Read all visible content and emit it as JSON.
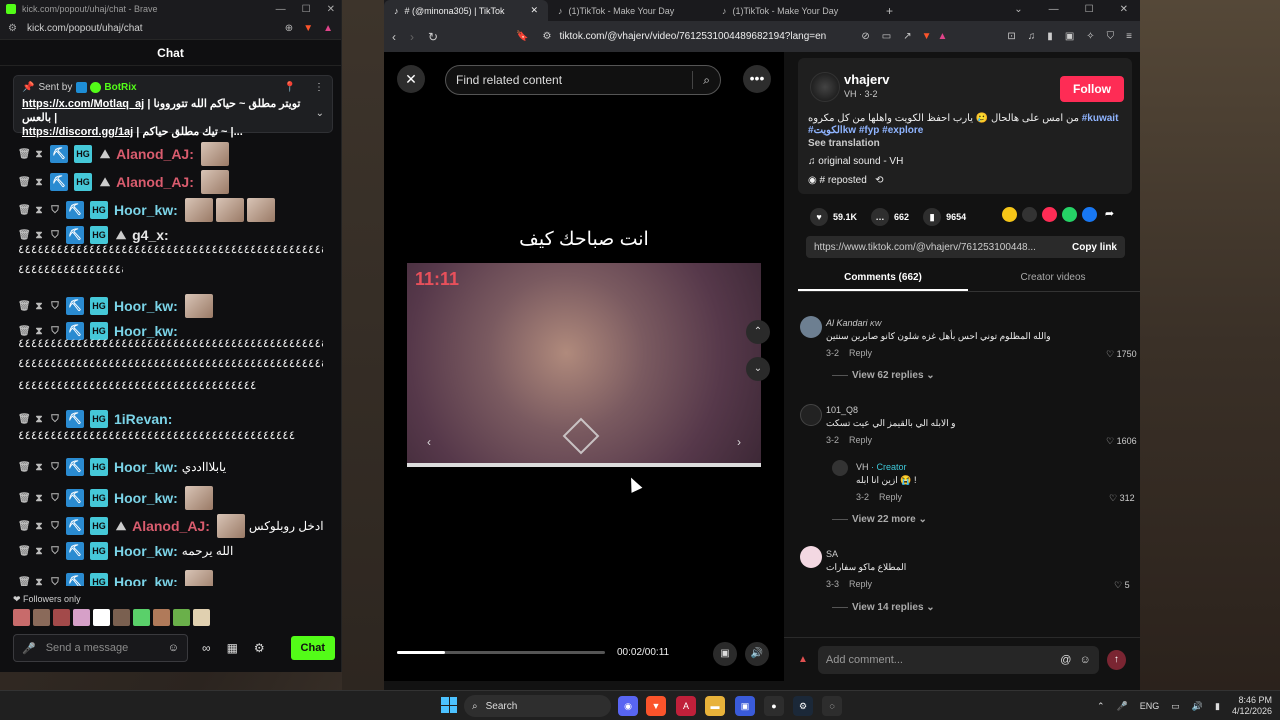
{
  "kick": {
    "window_title": "kick.com/popout/uhaj/chat - Brave",
    "url": "kick.com/popout/uhaj/chat",
    "chat_header": "Chat",
    "pinned": {
      "sent_by": "Sent by",
      "bot_name": "BotRix",
      "line1_link": "https://x.com/Motlaq_aj",
      "line1_text": "| تويتر مطلق ~ حياكم الله تتوروونا بالعس |",
      "line2_link": "https://discord.gg/1aj",
      "line2_text": "| تيك مطلق حياكم ~ |..."
    },
    "messages": [
      {
        "user": "Alanod_AJ:",
        "color": "#d95c6e",
        "mountain": true
      },
      {
        "user": "Alanod_AJ:",
        "color": "#d95c6e",
        "mountain": true
      },
      {
        "user": "Hoor_kw:",
        "color": "#7bd4e8"
      },
      {
        "user": "g4_x:",
        "color": "#e6e6e6",
        "mountain": true
      },
      {
        "user": "Hoor_kw:",
        "color": "#7bd4e8"
      },
      {
        "user": "Hoor_kw:",
        "color": "#7bd4e8"
      },
      {
        "user": "1iRevan:",
        "color": "#7bd4e8"
      },
      {
        "user": "Hoor_kw:",
        "color": "#7bd4e8",
        "text": "يابلاااددي"
      },
      {
        "user": "Hoor_kw:",
        "color": "#7bd4e8"
      },
      {
        "user": "Alanod_AJ:",
        "color": "#d95c6e",
        "mountain": true,
        "text": "ادخل روبلوكس"
      },
      {
        "user": "Hoor_kw:",
        "color": "#7bd4e8",
        "text": "الله يرحمه"
      },
      {
        "user": "Hoor_kw:",
        "color": "#7bd4e8"
      }
    ],
    "followers_only": "Followers only",
    "input_placeholder": "Send a message",
    "chat_button": "Chat"
  },
  "brave": {
    "tabs": [
      {
        "title": "# (@minona305) | TikTok",
        "active": true
      },
      {
        "title": "(1)TikTok - Make Your Day",
        "active": false
      },
      {
        "title": "(1)TikTok - Make Your Day",
        "active": false
      }
    ],
    "address": "tiktok.com/@vhajerv/video/7612531004489682194?lang=en"
  },
  "tiktok": {
    "search_placeholder": "Find related content",
    "caption": "انت صباحك كيف",
    "video_counter": "11:11",
    "progress": 0.23,
    "time": "00:02/00:11",
    "author": {
      "name": "vhajerv",
      "sub": "VH · 3-2",
      "follow": "Follow",
      "desc_text": "من امس على هالحال 🥲 يارب احفظ الكويت واهلها من كل مكروه",
      "tags": [
        "#kuwait",
        "#الكويتkw",
        "#fyp",
        "#explore"
      ],
      "see_translation": "See translation",
      "sound": "original sound - VH",
      "reposted": "# reposted"
    },
    "stats": {
      "likes": "59.1K",
      "comments": "662",
      "saves": "9654"
    },
    "share_colors": [
      "#f5c518",
      "#333333",
      "#fe2c55",
      "#25d366",
      "#1877f2"
    ],
    "link": "https://www.tiktok.com/@vhajerv/761253100448...",
    "copy_link": "Copy link",
    "tab_comments": "Comments (662)",
    "tab_creator": "Creator videos",
    "comments": [
      {
        "name": "Al Kandari",
        "name_suffix": "KW",
        "text": "والله المظلوم توني احس بأهل غزه شلون كانو صابرين سنتين",
        "date": "3-2",
        "reply": "Reply",
        "likes": "1750",
        "more": "View 62 replies"
      },
      {
        "name": "101_Q8",
        "text": "و الابله الي بالقيمز الي عيت تسكت",
        "date": "3-2",
        "reply": "Reply",
        "likes": "1606"
      },
      {
        "name": "VH",
        "creator": "· Creator",
        "text": "ازين انا ابله 😭 !",
        "date": "3-2",
        "reply": "Reply",
        "likes": "312",
        "more": "View 22 more"
      },
      {
        "name": "SA",
        "text": "المطلاع ماكو سفارات",
        "date": "3-3",
        "reply": "Reply",
        "likes": "5",
        "more": "View 14 replies"
      }
    ],
    "add_comment": "Add comment..."
  },
  "taskbar": {
    "search": "Search",
    "lang": "ENG",
    "time": "8:46 PM",
    "date": "4/12/2026"
  }
}
